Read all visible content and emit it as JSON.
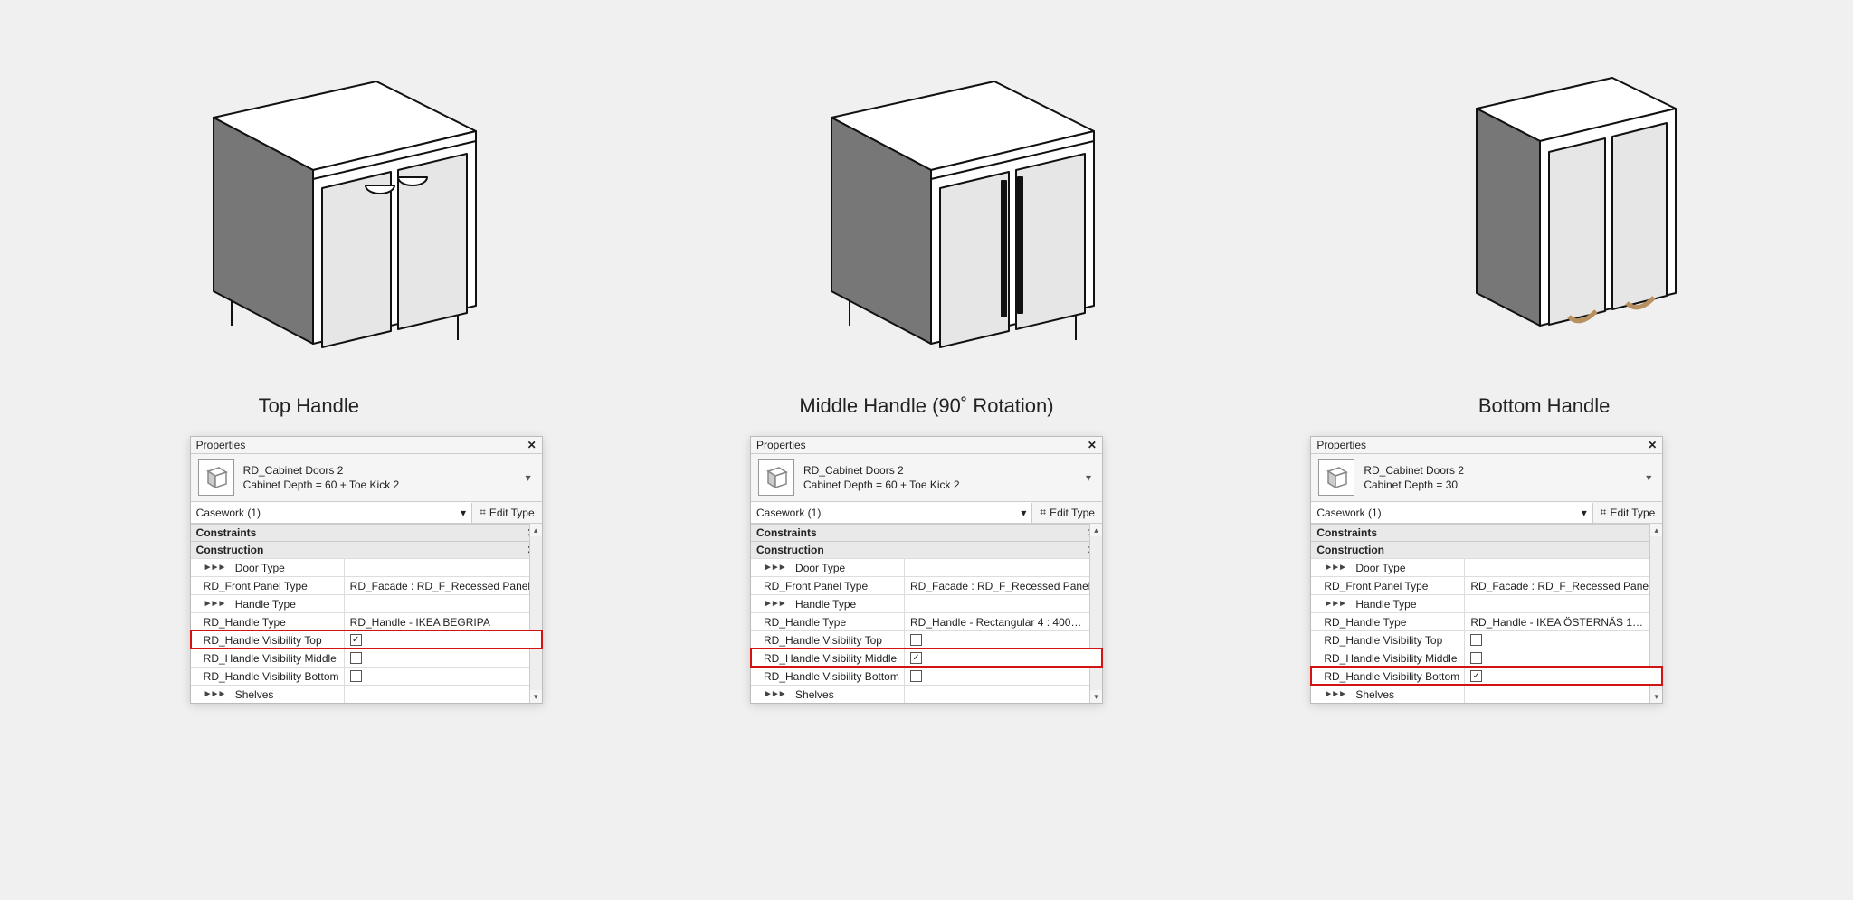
{
  "captions": [
    "Top Handle",
    "Middle Handle (90˚ Rotation)",
    "Bottom Handle"
  ],
  "panelCommon": {
    "title": "Properties",
    "editType": "Edit Type",
    "filterLabel": "Casework (1)",
    "sectionConstraints": "Constraints",
    "sectionConstruction": "Construction",
    "rows": {
      "doorType": "Door Type",
      "frontPanel": "RD_Front Panel Type<Casework>",
      "handleType": "Handle Type",
      "handleTypeCw": "RD_Handle Type<Casework>",
      "visTop": "RD_Handle Visibility Top",
      "visMid": "RD_Handle Visibility Middle",
      "visBot": "RD_Handle Visibility Bottom",
      "shelves": "Shelves"
    },
    "frontPanelValue": "RD_Facade : RD_F_Recessed Panel"
  },
  "panels": [
    {
      "typeName": "RD_Cabinet Doors 2",
      "typeSub": "Cabinet Depth = 60 + Toe Kick 2",
      "handleValue": "RD_Handle - IKEA BEGRIPA",
      "checked": "top",
      "highlight": "top",
      "showShelves": false
    },
    {
      "typeName": "RD_Cabinet Doors 2",
      "typeSub": "Cabinet Depth = 60 + Toe Kick 2",
      "handleValue": "RD_Handle - Rectangular 4 : 400…",
      "checked": "mid",
      "highlight": "mid",
      "showShelves": false
    },
    {
      "typeName": "RD_Cabinet Doors 2",
      "typeSub": "Cabinet Depth = 30",
      "handleValue": "RD_Handle - IKEA ÖSTERNÄS 1…",
      "checked": "bot",
      "highlight": "bot",
      "showShelves": true
    }
  ]
}
